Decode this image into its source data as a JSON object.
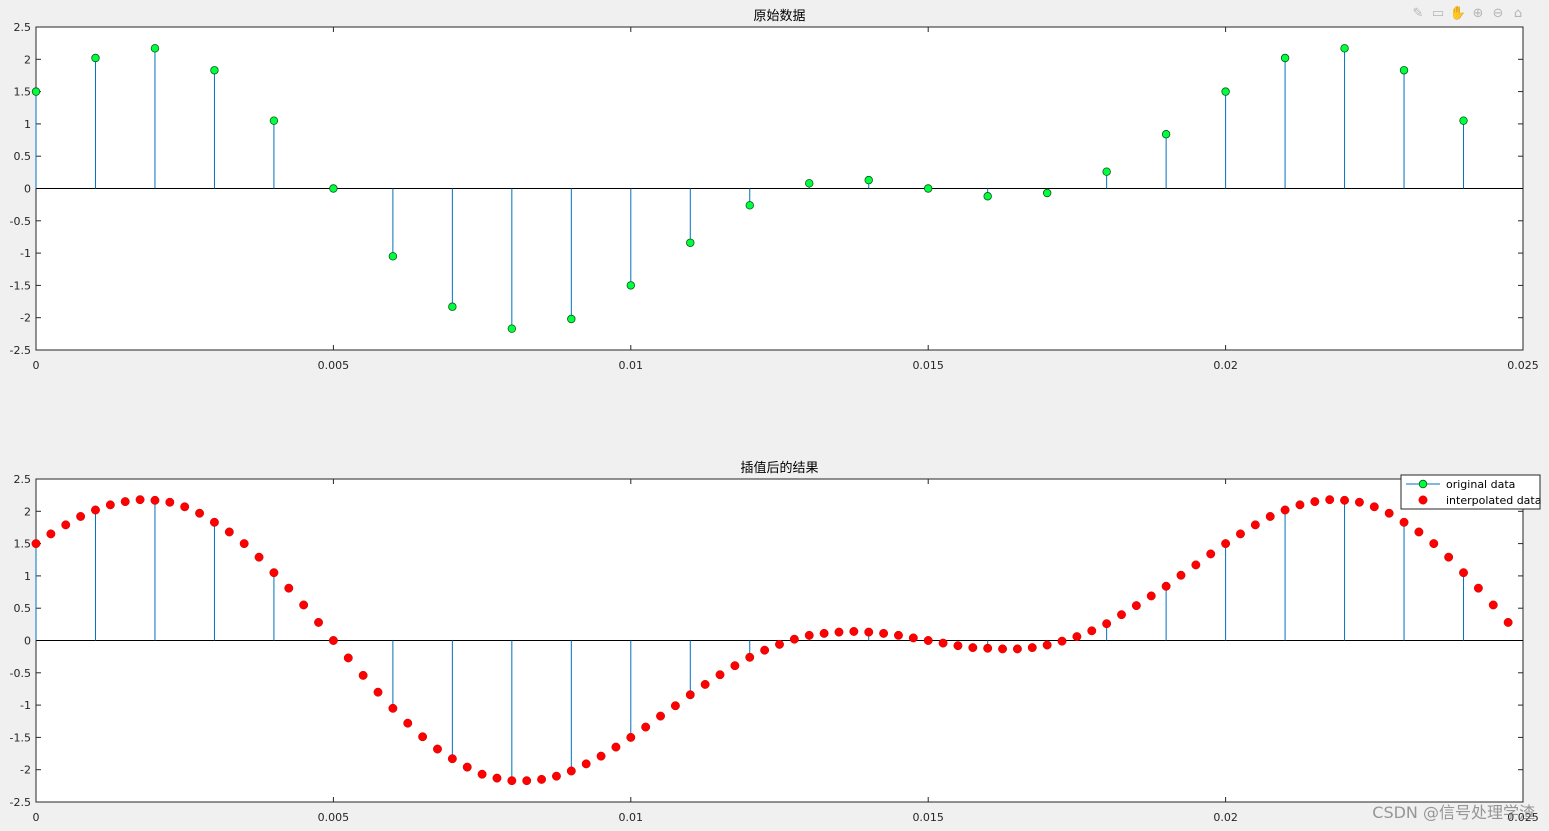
{
  "toolbar": {
    "icons": [
      "brush-icon",
      "datatip-icon",
      "pan-icon",
      "zoom-in-icon",
      "zoom-out-icon",
      "home-icon"
    ]
  },
  "watermark": "CSDN @信号处理学渣",
  "colors": {
    "stem": "#0072bd",
    "marker_original": "#00ff40",
    "marker_interp": "#ff0000",
    "axis": "#262626",
    "grid_bg": "#ffffff"
  },
  "chart_data": [
    {
      "type": "stem",
      "title": "原始数据",
      "xlabel": "",
      "ylabel": "",
      "xlim": [
        0,
        0.025
      ],
      "ylim": [
        -2.5,
        2.5
      ],
      "xticks": [
        0,
        0.005,
        0.01,
        0.015,
        0.02,
        0.025
      ],
      "xtick_labels": [
        "0",
        "0.005",
        "0.01",
        "0.015",
        "0.02",
        "0.025"
      ],
      "yticks": [
        2.5,
        2,
        1.5,
        1,
        0.5,
        0,
        -0.5,
        -1,
        -1.5,
        -2,
        -2.5
      ],
      "ytick_labels": [
        "2.5",
        "2",
        "1.5",
        "1",
        "0.5",
        "0",
        "-0.5",
        "-1",
        "-1.5",
        "-2",
        "-2.5"
      ],
      "grid": false,
      "series": [
        {
          "marker": "green-circle",
          "x": [
            0,
            0.001,
            0.002,
            0.003,
            0.004,
            0.005,
            0.006,
            0.007,
            0.008,
            0.009,
            0.01,
            0.011,
            0.012,
            0.013,
            0.014,
            0.015,
            0.016,
            0.017,
            0.018,
            0.019,
            0.02,
            0.021,
            0.022,
            0.023,
            0.024
          ],
          "y": [
            1.5,
            2.02,
            2.17,
            1.83,
            1.05,
            0.0,
            -1.05,
            -1.83,
            -2.17,
            -2.02,
            -1.5,
            -0.84,
            -0.26,
            0.08,
            0.13,
            0.0,
            -0.12,
            -0.07,
            0.26,
            0.84,
            1.5,
            2.02,
            2.17,
            1.83,
            1.05
          ]
        }
      ]
    },
    {
      "type": "stem+scatter",
      "title": "插值后的结果",
      "xlabel": "",
      "ylabel": "",
      "xlim": [
        0,
        0.025
      ],
      "ylim": [
        -2.5,
        2.5
      ],
      "xticks": [
        0,
        0.005,
        0.01,
        0.015,
        0.02,
        0.025
      ],
      "xtick_labels": [
        "0",
        "0.005",
        "0.01",
        "0.015",
        "0.02",
        "0.025"
      ],
      "yticks": [
        2.5,
        2,
        1.5,
        1,
        0.5,
        0,
        -0.5,
        -1,
        -1.5,
        -2,
        -2.5
      ],
      "ytick_labels": [
        "2.5",
        "2",
        "1.5",
        "1",
        "0.5",
        "0",
        "-0.5",
        "-1",
        "-1.5",
        "-2",
        "-2.5"
      ],
      "grid": false,
      "legend_position": "top-right",
      "legend": [
        "original data",
        "interpolated data"
      ],
      "series": [
        {
          "name": "original data",
          "marker": "stem-only",
          "x": [
            0,
            0.001,
            0.002,
            0.003,
            0.004,
            0.005,
            0.006,
            0.007,
            0.008,
            0.009,
            0.01,
            0.011,
            0.012,
            0.013,
            0.014,
            0.015,
            0.016,
            0.017,
            0.018,
            0.019,
            0.02,
            0.021,
            0.022,
            0.023,
            0.024
          ],
          "y": [
            1.5,
            2.02,
            2.17,
            1.83,
            1.05,
            0.0,
            -1.05,
            -1.83,
            -2.17,
            -2.02,
            -1.5,
            -0.84,
            -0.26,
            0.08,
            0.13,
            0.0,
            -0.12,
            -0.07,
            0.26,
            0.84,
            1.5,
            2.02,
            2.17,
            1.83,
            1.05
          ]
        },
        {
          "name": "interpolated data",
          "marker": "red-dot",
          "x": [
            0,
            0.00025,
            0.0005,
            0.00075,
            0.001,
            0.00125,
            0.0015,
            0.00175,
            0.002,
            0.00225,
            0.0025,
            0.00275,
            0.003,
            0.00325,
            0.0035,
            0.00375,
            0.004,
            0.00425,
            0.0045,
            0.00475,
            0.005,
            0.00525,
            0.0055,
            0.00575,
            0.006,
            0.00625,
            0.0065,
            0.00675,
            0.007,
            0.00725,
            0.0075,
            0.00775,
            0.008,
            0.00825,
            0.0085,
            0.00875,
            0.009,
            0.00925,
            0.0095,
            0.00975,
            0.01,
            0.01025,
            0.0105,
            0.01075,
            0.011,
            0.01125,
            0.0115,
            0.01175,
            0.012,
            0.01225,
            0.0125,
            0.01275,
            0.013,
            0.01325,
            0.0135,
            0.01375,
            0.014,
            0.01425,
            0.0145,
            0.01475,
            0.015,
            0.01525,
            0.0155,
            0.01575,
            0.016,
            0.01625,
            0.0165,
            0.01675,
            0.017,
            0.01725,
            0.0175,
            0.01775,
            0.018,
            0.01825,
            0.0185,
            0.01875,
            0.019,
            0.01925,
            0.0195,
            0.01975,
            0.02,
            0.02025,
            0.0205,
            0.02075,
            0.021,
            0.02125,
            0.0215,
            0.02175,
            0.022,
            0.02225,
            0.0225,
            0.02275,
            0.023,
            0.02325,
            0.0235,
            0.02375,
            0.024,
            0.02425,
            0.0245,
            0.02475
          ],
          "y": [
            1.5,
            1.65,
            1.79,
            1.92,
            2.02,
            2.1,
            2.15,
            2.18,
            2.17,
            2.14,
            2.07,
            1.97,
            1.83,
            1.68,
            1.5,
            1.29,
            1.05,
            0.81,
            0.55,
            0.28,
            0.0,
            -0.27,
            -0.54,
            -0.8,
            -1.05,
            -1.28,
            -1.49,
            -1.68,
            -1.83,
            -1.96,
            -2.07,
            -2.13,
            -2.17,
            -2.17,
            -2.15,
            -2.1,
            -2.02,
            -1.91,
            -1.79,
            -1.65,
            -1.5,
            -1.34,
            -1.17,
            -1.01,
            -0.84,
            -0.68,
            -0.53,
            -0.39,
            -0.26,
            -0.15,
            -0.06,
            0.02,
            0.08,
            0.11,
            0.13,
            0.14,
            0.13,
            0.11,
            0.08,
            0.04,
            0.0,
            -0.04,
            -0.08,
            -0.11,
            -0.12,
            -0.13,
            -0.13,
            -0.11,
            -0.07,
            -0.01,
            0.06,
            0.15,
            0.26,
            0.4,
            0.54,
            0.69,
            0.84,
            1.01,
            1.17,
            1.34,
            1.5,
            1.65,
            1.79,
            1.92,
            2.02,
            2.1,
            2.15,
            2.18,
            2.17,
            2.14,
            2.07,
            1.97,
            1.83,
            1.68,
            1.5,
            1.29,
            1.05,
            0.81,
            0.55,
            0.28
          ]
        }
      ]
    }
  ]
}
